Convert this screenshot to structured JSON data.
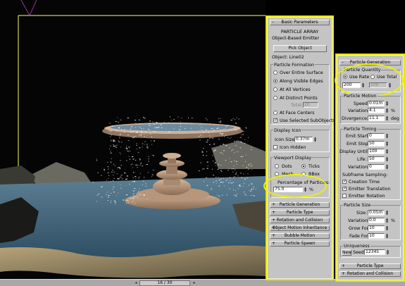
{
  "viewport": {
    "frame": "16 / 30"
  },
  "colors": {
    "highlight": "#f0f000",
    "panel": "#c4c4c4",
    "particle": "#ffffff"
  },
  "panel1": {
    "basic_params": "Basic Parameters",
    "title": "PARTICLE ARRAY",
    "emitter_label": "Object-Based Emitter",
    "pick_object": "Pick Object",
    "object_label": "Object: Line02",
    "formation": {
      "title": "Particle Formation",
      "over_surface": "Over Entire Surface",
      "along_edges": "Along Visible Edges",
      "all_vertices": "At All Vertices",
      "distinct_points": "At Distinct Points",
      "total_label": "Total:",
      "total_value": "20",
      "face_centers": "At Face Centers",
      "use_selected": "Use Selected SubObjects"
    },
    "display_icon": {
      "title": "Display Icon",
      "icon_size_label": "Icon Size:",
      "icon_size_value": "0.37m",
      "icon_hidden": "Icon Hidden"
    },
    "viewport_display": {
      "title": "Viewport Display",
      "dots": "Dots",
      "ticks": "Ticks",
      "mesh": "Mesh",
      "bbox": "BBox",
      "pct_label": "Percentage of Particles:",
      "pct_value": "75.0",
      "pct_unit": "%"
    },
    "rollouts": [
      "Particle Generation",
      "Particle Type",
      "Rotation and Collision",
      "Object Motion Inheritance",
      "Bubble Motion",
      "Particle Spawn"
    ]
  },
  "panel2": {
    "generation": "Particle Generation",
    "quantity": {
      "title": "Particle Quantity",
      "use_rate": "Use Rate",
      "use_total": "Use Total",
      "rate": "200",
      "total": "100"
    },
    "motion": {
      "title": "Particle Motion",
      "speed_label": "Speed:",
      "speed": "0.01m",
      "variation_label": "Variation:",
      "variation": "4.1",
      "variation_unit": "%",
      "divergence_label": "Divergence:",
      "divergence": "11.1",
      "divergence_unit": "deg"
    },
    "timing": {
      "title": "Particle Timing",
      "emit_start_label": "Emit Start:",
      "emit_start": "0",
      "emit_stop_label": "Emit Stop:",
      "emit_stop": "50",
      "display_until_label": "Display Until:",
      "display_until": "100",
      "life_label": "Life:",
      "life": "50",
      "variation_label": "Variation:",
      "variation": "0",
      "subframe": "Subframe Sampling:",
      "creation_time": "Creation Time",
      "emitter_translation": "Emitter Translation",
      "emitter_rotation": "Emitter Rotation"
    },
    "size": {
      "title": "Particle Size",
      "size_label": "Size:",
      "size": "0.05m",
      "variation_label": "Variation:",
      "variation": "0.0",
      "variation_unit": "%",
      "grow_label": "Grow For:",
      "grow": "10",
      "fade_label": "Fade For:",
      "fade": "10"
    },
    "uniqueness": {
      "title": "Uniqueness",
      "new": "New",
      "seed_label": "Seed:",
      "seed": "12345"
    },
    "rollouts": [
      "Particle Type",
      "Rotation and Collision"
    ]
  }
}
